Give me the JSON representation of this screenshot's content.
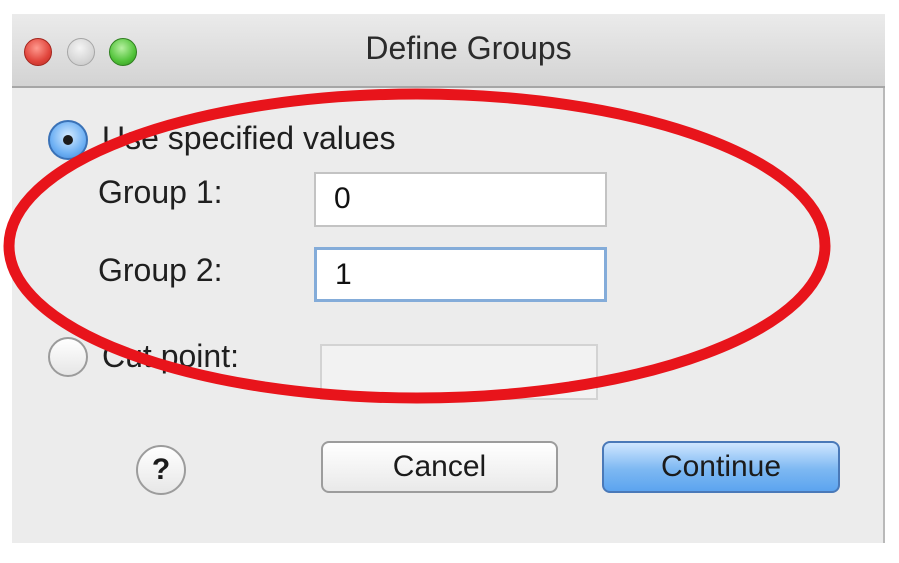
{
  "window": {
    "title": "Define Groups"
  },
  "options": {
    "use_specified_label": "Use specified values",
    "cut_point_label": "Cut point:",
    "selected": "use_specified"
  },
  "group1": {
    "label": "Group 1:",
    "value": "0"
  },
  "group2": {
    "label": "Group 2:",
    "value": "1"
  },
  "cut_point": {
    "value": ""
  },
  "buttons": {
    "help_label": "?",
    "cancel_label": "Cancel",
    "continue_label": "Continue"
  },
  "annotation": {
    "shape": "ellipse",
    "color": "#e8141b"
  }
}
